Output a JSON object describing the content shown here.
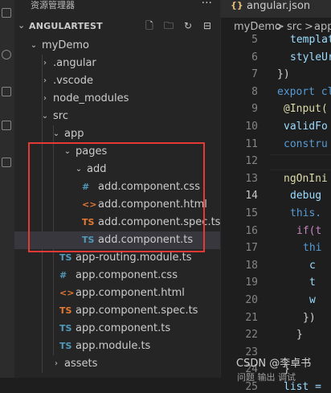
{
  "sidebar": {
    "title": "资源管理器",
    "more": "···",
    "section_name": "ANGULARTEST",
    "tree": [
      {
        "label": "myDemo",
        "icon": "",
        "chevron": "down"
      },
      {
        "label": ".angular",
        "icon": "",
        "chevron": "right"
      },
      {
        "label": ".vscode",
        "icon": "",
        "chevron": "right"
      },
      {
        "label": "node_modules",
        "icon": "",
        "chevron": "right"
      },
      {
        "label": "src",
        "icon": "",
        "chevron": "down"
      },
      {
        "label": "app",
        "icon": "",
        "chevron": "down"
      },
      {
        "label": "pages",
        "icon": "",
        "chevron": "down"
      },
      {
        "label": "add",
        "icon": "",
        "chevron": "down"
      },
      {
        "label": "add.component.css",
        "icon": "#",
        "chevron": ""
      },
      {
        "label": "add.component.html",
        "icon": "<>",
        "chevron": ""
      },
      {
        "label": "add.component.spec.ts",
        "icon": "TS",
        "chevron": ""
      },
      {
        "label": "add.component.ts",
        "icon": "TS",
        "chevron": ""
      },
      {
        "label": "app-routing.module.ts",
        "icon": "TS",
        "chevron": ""
      },
      {
        "label": "app.component.css",
        "icon": "#",
        "chevron": ""
      },
      {
        "label": "app.component.html",
        "icon": "<>",
        "chevron": ""
      },
      {
        "label": "app.component.spec.ts",
        "icon": "TS",
        "chevron": ""
      },
      {
        "label": "app.component.ts",
        "icon": "TS",
        "chevron": ""
      },
      {
        "label": "app.module.ts",
        "icon": "TS",
        "chevron": ""
      },
      {
        "label": "assets",
        "icon": "",
        "chevron": "right"
      }
    ]
  },
  "editor": {
    "tab_icon": "{}",
    "tab_label": "angular.json",
    "breadcrumb": [
      "myDemo",
      ">",
      "src",
      ">",
      "app"
    ],
    "lines": [
      {
        "num": "5",
        "text": "templat"
      },
      {
        "num": "6",
        "text": "styleUr"
      },
      {
        "num": "7",
        "text": "})"
      },
      {
        "num": "8",
        "text": "export cl"
      },
      {
        "num": "9",
        "text": "@Input("
      },
      {
        "num": "10",
        "text": "validFo"
      },
      {
        "num": "11",
        "text": "constru"
      },
      {
        "num": "12",
        "text": ""
      },
      {
        "num": "13",
        "text": "ngOnIni"
      },
      {
        "num": "14",
        "text": "debug"
      },
      {
        "num": "15",
        "text": "this."
      },
      {
        "num": "16",
        "text": "if(t"
      },
      {
        "num": "17",
        "text": "thi"
      },
      {
        "num": "18",
        "text": "c"
      },
      {
        "num": "19",
        "text": "t"
      },
      {
        "num": "20",
        "text": "w"
      },
      {
        "num": "21",
        "text": "})"
      },
      {
        "num": "22",
        "text": "}"
      },
      {
        "num": "23",
        "text": ""
      },
      {
        "num": "24",
        "text": "}"
      },
      {
        "num": "25",
        "text": "list ="
      }
    ]
  },
  "watermark": "CSDN @李卓书",
  "panel_tabs": "问题   输出   调试"
}
